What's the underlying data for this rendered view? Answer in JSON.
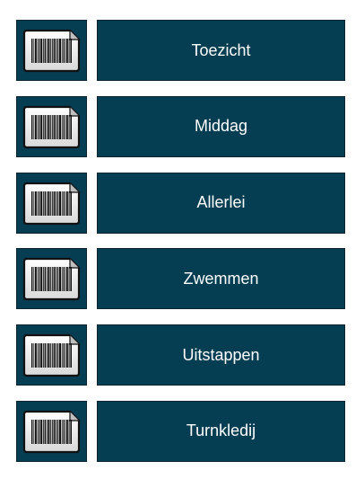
{
  "colors": {
    "button_bg": "#053d52",
    "button_border": "#0b2530",
    "button_text": "#ffffff"
  },
  "rows": [
    {
      "label": "Toezicht",
      "icon": "barcode-card-icon"
    },
    {
      "label": "Middag",
      "icon": "barcode-card-icon"
    },
    {
      "label": "Allerlei",
      "icon": "barcode-card-icon"
    },
    {
      "label": "Zwemmen",
      "icon": "barcode-card-icon"
    },
    {
      "label": "Uitstappen",
      "icon": "barcode-card-icon"
    },
    {
      "label": "Turnkledij",
      "icon": "barcode-card-icon"
    }
  ]
}
